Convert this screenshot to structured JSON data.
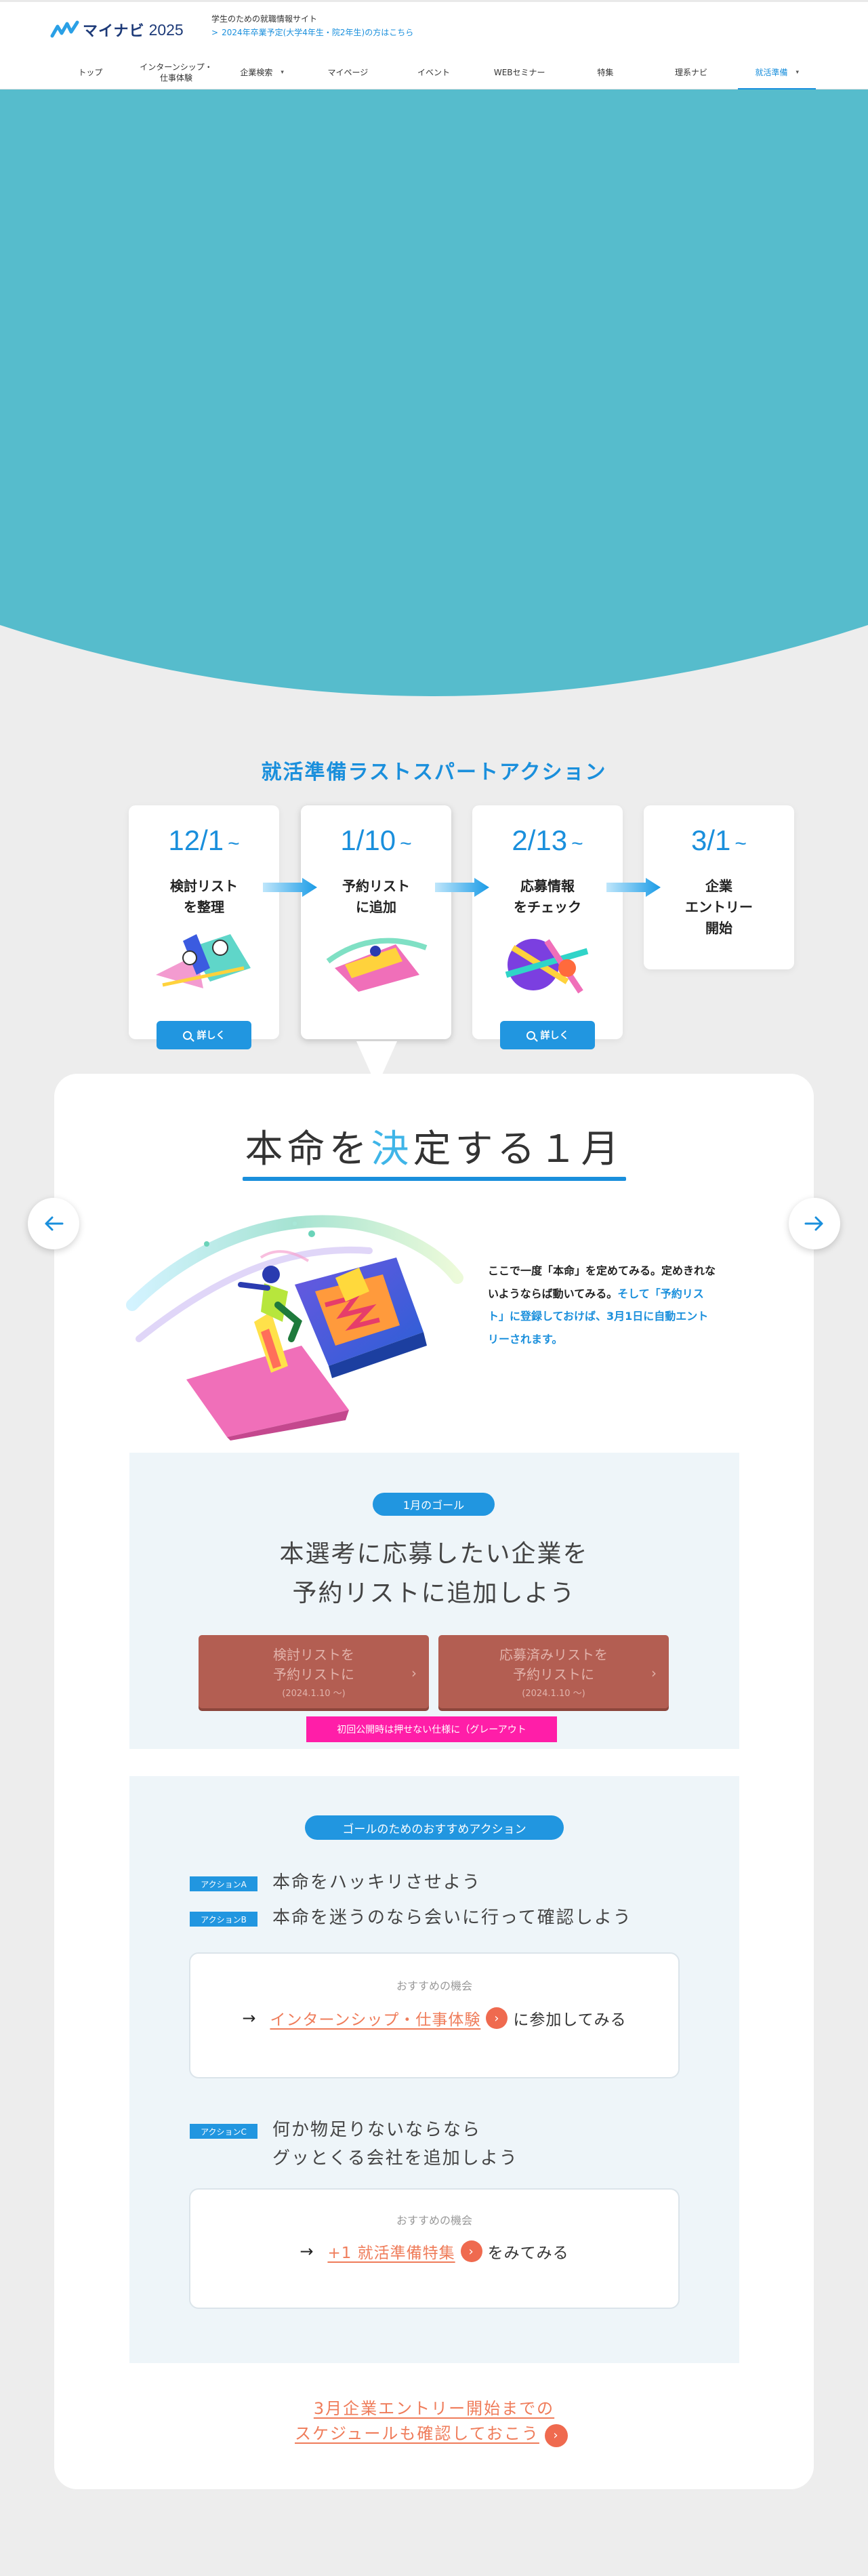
{
  "header": {
    "logo_text": "マイナビ",
    "logo_year": "2025",
    "site_description": "学生のための就職情報サイト",
    "site_link_arrow": ">",
    "site_link": "2024年卒業予定(大学4年生・院2年生)の方はこちら"
  },
  "nav": {
    "items": [
      {
        "label": "トップ"
      },
      {
        "label": "インターンシップ・\n仕事体験"
      },
      {
        "label": "企業検索"
      },
      {
        "label": "マイページ"
      },
      {
        "label": "イベント"
      },
      {
        "label": "WEBセミナー"
      },
      {
        "label": "特集"
      },
      {
        "label": "理系ナビ"
      },
      {
        "label": "就活準備"
      }
    ],
    "caret": "▾",
    "active_index": 8
  },
  "colors": {
    "accent": "#1a8fdc",
    "hero": "#56bccc",
    "orange": "#ef6a4f",
    "note": "#ff1ea8"
  },
  "schedule": {
    "title": "就活準備ラストスパートアクション",
    "tilde": "~",
    "detail_label": "詳しく",
    "steps": [
      {
        "date": "12/1",
        "label": "検討リスト\nを整理",
        "has_detail": true
      },
      {
        "date": "1/10",
        "label": "予約リスト\nに追加",
        "has_detail": false
      },
      {
        "date": "2/13",
        "label": "応募情報\nをチェック",
        "has_detail": true
      },
      {
        "date": "3/1",
        "label": "企業\nエントリー\n開始",
        "has_detail": false
      }
    ]
  },
  "month": {
    "heading_before": "本命を",
    "heading_highlight": "決",
    "heading_after": "定する１月",
    "intro_plain": "ここで一度「本命」を定めてみる。定めきれないようならば動いてみる。",
    "intro_emphasis": "そして「予約リスト」に登録しておけば、3月1日に自動エントリーされます。"
  },
  "goal": {
    "tag": "1月のゴール",
    "text": "本選考に応募したい企業を\n予約リストに追加しよう",
    "buttons": [
      {
        "label": "検討リストを\n予約リストに",
        "date": "(2024.1.10 ～)"
      },
      {
        "label": "応募済みリストを\n予約リストに",
        "date": "(2024.1.10 ～)"
      }
    ],
    "chevron": "›",
    "note": "初回公開時は押せない仕様に（グレーアウト"
  },
  "actions": {
    "tag": "ゴールのためのおすすめアクション",
    "items": [
      {
        "badge": "アクションA",
        "text": "本命をハッキリさせよう"
      },
      {
        "badge": "アクションB",
        "text": "本命を迷うのなら会いに行って確認しよう"
      },
      {
        "badge": "アクションC",
        "text": "何か物足りないならなら\nグッとくる会社を追加しよう"
      }
    ],
    "recommend_label": "おすすめの機会",
    "go_arrow": "→",
    "circle_arrow": "›",
    "rec1": {
      "link": "インターンシップ・仕事体験",
      "suffix": "に参加してみる"
    },
    "rec2": {
      "link": "+1 就活準備特集",
      "suffix": "をみてみる"
    }
  },
  "footer_link": {
    "line1": "3月企業エントリー開始までの",
    "line2": "スケジュールも確認しておこう"
  }
}
